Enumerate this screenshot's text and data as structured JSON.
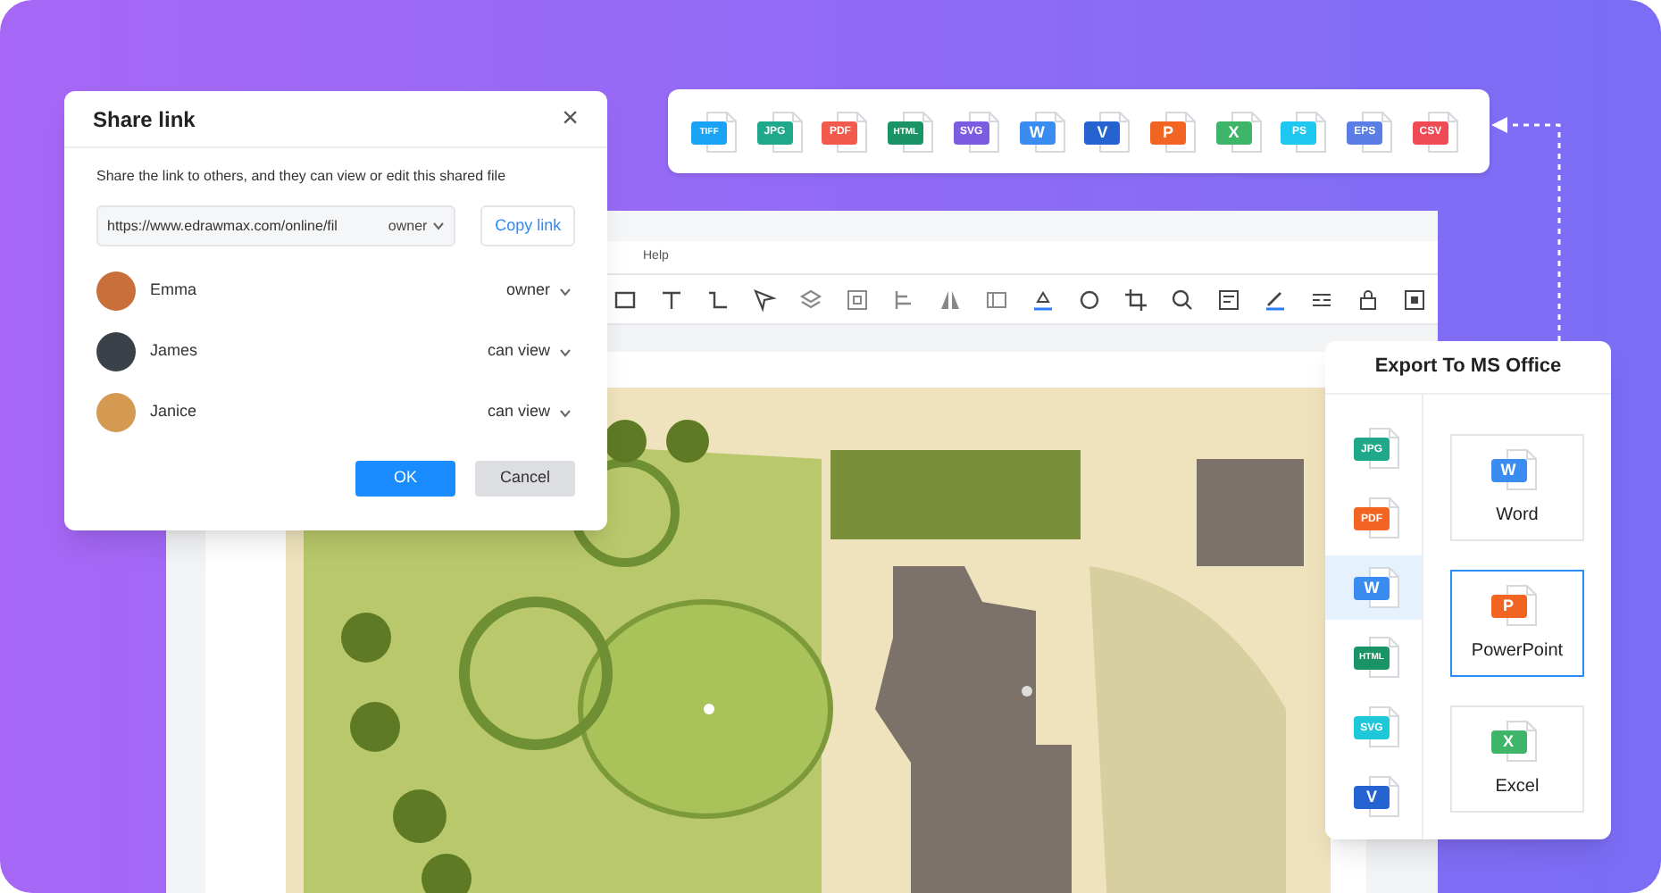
{
  "share_dialog": {
    "title": "Share link",
    "close": "×",
    "description": "Share the link to others, and they can view or edit this shared file",
    "link": {
      "value": "https://www.edrawmax.com/online/fil",
      "permission": "owner"
    },
    "copy_button": "Copy link",
    "people": [
      {
        "name": "Emma",
        "permission": "owner",
        "color": "#c9703a"
      },
      {
        "name": "James",
        "permission": "can view",
        "color": "#3b4148"
      },
      {
        "name": "Janice",
        "permission": "can view",
        "color": "#d49a52"
      }
    ],
    "buttons": [
      {
        "label": "OK",
        "kind": "primary"
      },
      {
        "label": "Cancel",
        "kind": "secondary"
      }
    ]
  },
  "format_bar": {
    "formats": [
      {
        "label": "TIFF",
        "color": "#1aa3f5"
      },
      {
        "label": "JPG",
        "color": "#1fa88a"
      },
      {
        "label": "PDF",
        "color": "#f15a4d"
      },
      {
        "label": "HTML",
        "color": "#1a9366"
      },
      {
        "label": "SVG",
        "color": "#7b5ce0"
      },
      {
        "label": "W",
        "color": "#3b8cf0"
      },
      {
        "label": "V",
        "color": "#2563d0"
      },
      {
        "label": "P",
        "color": "#f26422"
      },
      {
        "label": "X",
        "color": "#3fb56a"
      },
      {
        "label": "PS",
        "color": "#1ec8f0"
      },
      {
        "label": "EPS",
        "color": "#5a7ee6"
      },
      {
        "label": "CSV",
        "color": "#ef4b55"
      }
    ]
  },
  "app": {
    "menu": [
      "Help"
    ]
  },
  "export_panel": {
    "title": "Export To MS Office",
    "side_formats": [
      {
        "label": "JPG",
        "color": "#1fa88a",
        "selected": false
      },
      {
        "label": "PDF",
        "color": "#f26422",
        "selected": false
      },
      {
        "label": "W",
        "color": "#3b8cf0",
        "selected": true
      },
      {
        "label": "HTML",
        "color": "#1a9366",
        "selected": false
      },
      {
        "label": "SVG",
        "color": "#1ec8d8",
        "selected": false
      },
      {
        "label": "V",
        "color": "#2563d0",
        "selected": false
      }
    ],
    "options": [
      {
        "label": "Word",
        "icon": "W",
        "color": "#3b8cf0",
        "selected": false
      },
      {
        "label": "PowerPoint",
        "icon": "P",
        "color": "#f26422",
        "selected": true
      },
      {
        "label": "Excel",
        "icon": "X",
        "color": "#3fb56a",
        "selected": false
      }
    ]
  }
}
